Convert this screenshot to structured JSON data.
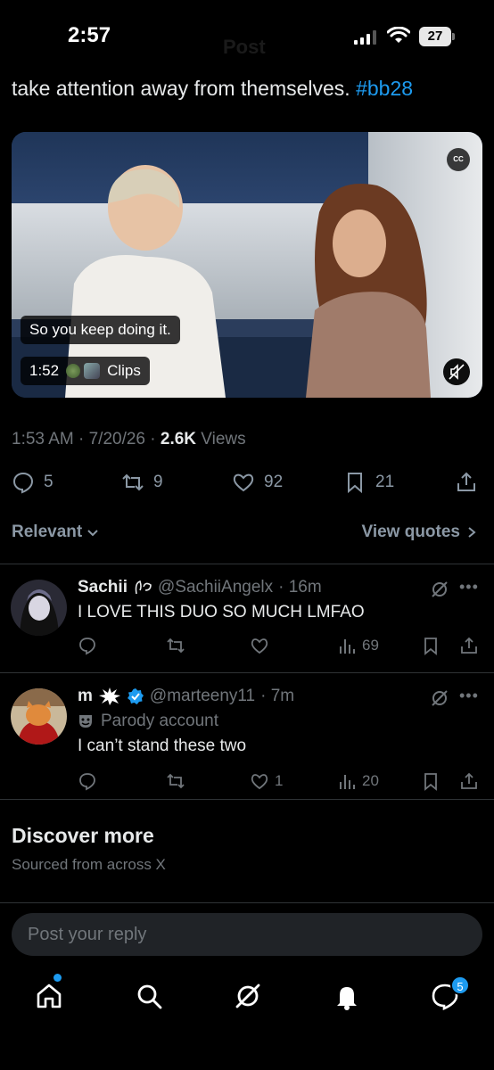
{
  "status": {
    "time": "2:57",
    "battery": "27",
    "ghost_title": "Post"
  },
  "post": {
    "text": "take attention away from themselves.",
    "hashtag": "#bb28",
    "video": {
      "cc": "CC",
      "caption": "So you keep doing it.",
      "duration": "1:52",
      "clips_label": "Clips"
    },
    "meta_time": "1:53 AM · 7/20/26 · ",
    "views_count": "2.6K",
    "views_label": " Views",
    "stats": {
      "replies": "5",
      "reposts": "9",
      "likes": "92",
      "bookmarks": "21"
    }
  },
  "sort": {
    "left_label": "Relevant",
    "right_label": "View quotes"
  },
  "replies": [
    {
      "name": "Sachii",
      "handle": "@SachiiAngelx",
      "time": "· 16m",
      "text": "I LOVE THIS DUO SO MUCH LMFAO",
      "views": "69",
      "likes": ""
    },
    {
      "name": "m",
      "handle": "@marteeny11",
      "time": "· 7m",
      "parody": "Parody account",
      "text": "I can’t stand these two",
      "likes": "1",
      "views": "20"
    }
  ],
  "discover": {
    "title": "Discover more",
    "subtitle": "Sourced from across X"
  },
  "reply_box": {
    "placeholder": "Post your reply"
  },
  "tabbar": {
    "messages_badge": "5"
  },
  "colors": {
    "accent": "#1d9bf0",
    "muted": "#71767b",
    "text": "#e7e9ea",
    "bg": "#000000"
  }
}
